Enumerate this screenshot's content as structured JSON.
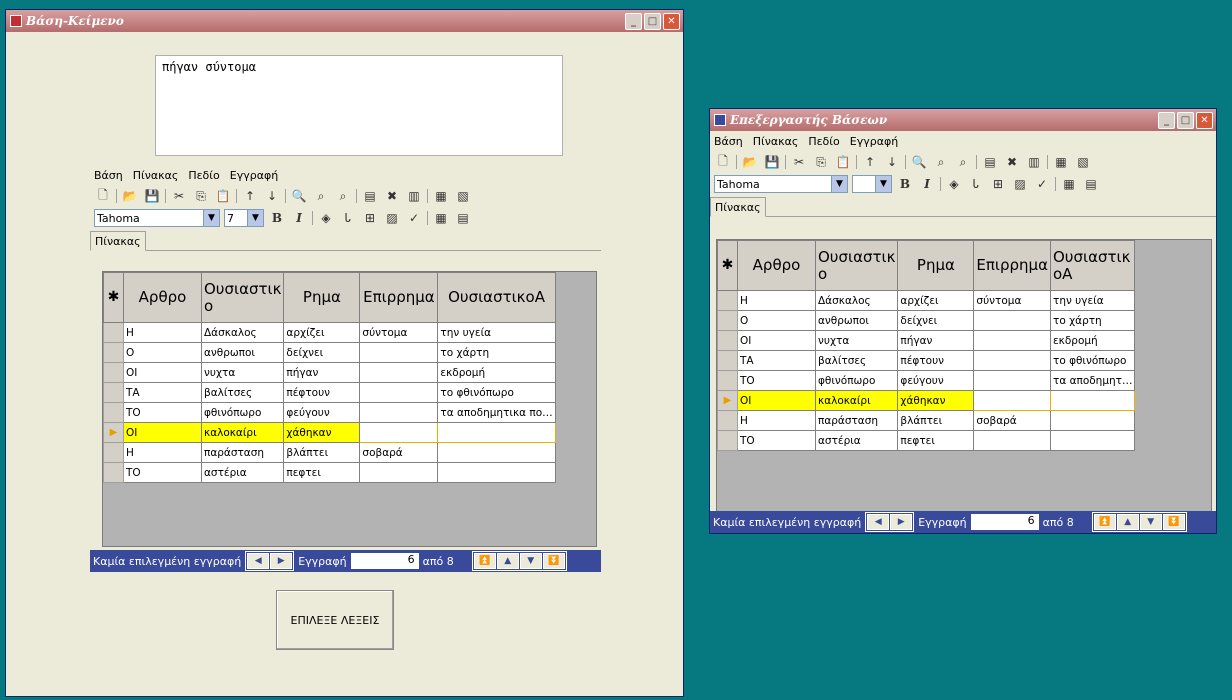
{
  "win1": {
    "title": "Βάση-Κείμενο",
    "textbox_text": "πήγαν  σύντομα",
    "menu": [
      "Βάση",
      "Πίνακας",
      "Πεδίο",
      "Εγγραφή"
    ],
    "font_name": "Tahoma",
    "font_size": "7",
    "tab_label": "Πίνακας",
    "columns": [
      "Αρθρο",
      "Ουσιαστικ ο",
      "Ρημα",
      "Επιρρημα",
      "ΟυσιαστικοΑ"
    ],
    "rows": [
      [
        "Η",
        "Δάσκαλος",
        "αρχίζει",
        "σύντομα",
        "την υγεία"
      ],
      [
        "Ο",
        "ανθρωποι",
        "δείχνει",
        "",
        "το χάρτη"
      ],
      [
        "ΟΙ",
        "νυχτα",
        "πήγαν",
        "",
        "εκδρομή"
      ],
      [
        "ΤΑ",
        "βαλίτσες",
        "πέφτουν",
        "",
        "το φθινόπωρο"
      ],
      [
        "ΤΟ",
        "φθινόπωρο",
        "φεύγουν",
        "",
        "τα αποδημητικα πο…"
      ],
      [
        "ΟΙ",
        "καλοκαίρι",
        "χάθηκαν",
        "",
        ""
      ],
      [
        "Η",
        "παράσταση",
        "βλάπτει",
        "σοβαρά",
        ""
      ],
      [
        "ΤΟ",
        "αστέρια",
        "πεφτει",
        "",
        ""
      ]
    ],
    "nav": {
      "status": "Καμία επιλεγμένη εγγραφή",
      "record_label": "Εγγραφή",
      "record_value": "6",
      "of_label": "από 8"
    },
    "button_label": "ΕΠΙΛΕΞΕ ΛΕΞΕΙΣ"
  },
  "win2": {
    "title": "Επεξεργαστής Βάσεων",
    "menu": [
      "Βάση",
      "Πίνακας",
      "Πεδίο",
      "Εγγραφή"
    ],
    "font_name": "Tahoma",
    "tab_label": "Πίνακας",
    "columns": [
      "Αρθρο",
      "Ουσιαστικ ο",
      "Ρημα",
      "Επιρρημα",
      "Ουσιαστικ οΑ"
    ],
    "rows": [
      [
        "Η",
        "Δάσκαλος",
        "αρχίζει",
        "σύντομα",
        "την υγεία"
      ],
      [
        "Ο",
        "ανθρωποι",
        "δείχνει",
        "",
        "το χάρτη"
      ],
      [
        "ΟΙ",
        "νυχτα",
        "πήγαν",
        "",
        "εκδρομή"
      ],
      [
        "ΤΑ",
        "βαλίτσες",
        "πέφτουν",
        "",
        "το φθινόπωρο"
      ],
      [
        "ΤΟ",
        "φθινόπωρο",
        "φεύγουν",
        "",
        "τα αποδημητ…"
      ],
      [
        "ΟΙ",
        "καλοκαίρι",
        "χάθηκαν",
        "",
        ""
      ],
      [
        "Η",
        "παράσταση",
        "βλάπτει",
        "σοβαρά",
        ""
      ],
      [
        "ΤΟ",
        "αστέρια",
        "πεφτει",
        "",
        ""
      ]
    ],
    "nav": {
      "status": "Καμία επιλεγμένη εγγραφή",
      "record_label": "Εγγραφή",
      "record_value": "6",
      "of_label": "από 8"
    }
  },
  "current_row_index": 5,
  "colors": {
    "desktop": "#06787f",
    "window_bg": "#ecead8",
    "highlight": "#ffff00",
    "navbar": "#3a4a9a"
  }
}
